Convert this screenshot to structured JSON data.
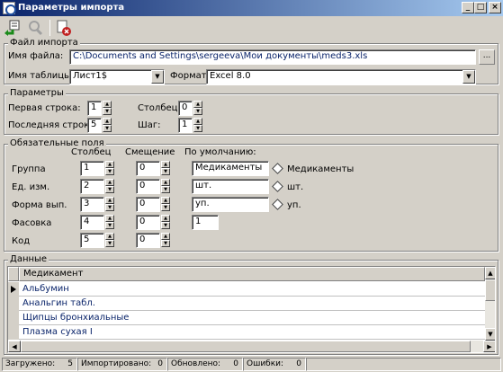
{
  "window": {
    "title": "Параметры импорта",
    "controls": {
      "minimize": "_",
      "maximize": "□",
      "close": "×"
    }
  },
  "toolbar": {
    "icons": [
      "import-icon",
      "search-icon",
      "clear-icon"
    ]
  },
  "file_group": {
    "title": "Файл импорта",
    "filename_label": "Имя файла:",
    "filename_value": "C:\\Documents and Settings\\sergeeva\\Мои документы\\meds3.xls",
    "browse_label": "...",
    "table_label": "Имя таблицы:",
    "table_value": "Лист1$",
    "format_label": "Формат:",
    "format_value": "Excel 8.0"
  },
  "params_group": {
    "title": "Параметры",
    "first_row_label": "Первая строка:",
    "first_row_value": "1",
    "last_row_label": "Последняя строка:",
    "last_row_value": "5",
    "column_label": "Столбец:",
    "column_value": "0",
    "step_label": "Шаг:",
    "step_value": "1"
  },
  "required_group": {
    "title": "Обязательные поля",
    "col_header": "Столбец",
    "offset_header": "Смещение",
    "default_header": "По умолчанию:",
    "rows": [
      {
        "label": "Группа",
        "column": "1",
        "offset": "0",
        "default": "Медикаменты",
        "default_hint": "Медикаменты"
      },
      {
        "label": "Ед. изм.",
        "column": "2",
        "offset": "0",
        "default": "шт.",
        "default_hint": "шт."
      },
      {
        "label": "Форма вып.",
        "column": "3",
        "offset": "0",
        "default": "уп.",
        "default_hint": "уп."
      },
      {
        "label": "Фасовка",
        "column": "4",
        "offset": "0",
        "default": "1",
        "default_hint": ""
      },
      {
        "label": "Код",
        "column": "5",
        "offset": "0",
        "default": "",
        "default_hint": ""
      }
    ]
  },
  "data_group": {
    "title": "Данные",
    "column_header": "Медикамент",
    "rows": [
      "Альбумин",
      "Анальгин табл.",
      "Щипцы бронхиальные",
      "Плазма сухая I"
    ]
  },
  "status": {
    "loaded_label": "Загружено:",
    "loaded_value": "5",
    "imported_label": "Импортировано:",
    "imported_value": "0",
    "updated_label": "Обновлено:",
    "updated_value": "0",
    "errors_label": "Ошибки:",
    "errors_value": "0"
  }
}
